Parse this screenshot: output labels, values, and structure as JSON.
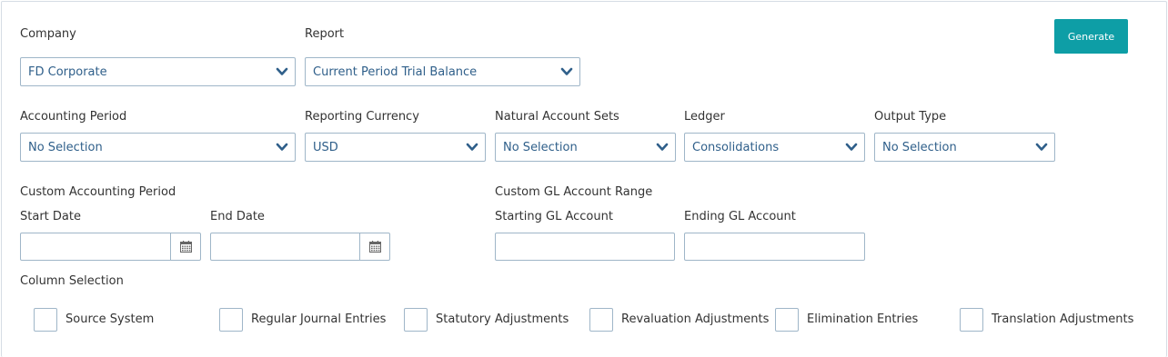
{
  "generate_label": "Generate",
  "icons": {
    "dropdown": "chevron-down-icon",
    "calendar": "calendar-icon"
  },
  "colors": {
    "accent": "#0e9ea6",
    "value_text": "#2f5f8a",
    "border": "#9fb6c8"
  },
  "fields": {
    "company": {
      "label": "Company",
      "value": "FD Corporate"
    },
    "report": {
      "label": "Report",
      "value": "Current Period Trial Balance"
    },
    "accounting_period": {
      "label": "Accounting Period",
      "value": "No Selection"
    },
    "reporting_currency": {
      "label": "Reporting Currency",
      "value": "USD"
    },
    "natural_account_sets": {
      "label": "Natural Account Sets",
      "value": "No Selection"
    },
    "ledger": {
      "label": "Ledger",
      "value": "Consolidations"
    },
    "output_type": {
      "label": "Output Type",
      "value": "No Selection"
    }
  },
  "custom_period": {
    "heading": "Custom Accounting Period",
    "start_label": "Start Date",
    "start_value": "",
    "end_label": "End Date",
    "end_value": ""
  },
  "gl_range": {
    "heading": "Custom GL Account Range",
    "start_label": "Starting GL Account",
    "start_value": "",
    "end_label": "Ending GL Account",
    "end_value": ""
  },
  "columns": {
    "heading": "Column Selection",
    "options": [
      {
        "label": "Source System",
        "checked": false
      },
      {
        "label": "Regular Journal Entries",
        "checked": false
      },
      {
        "label": "Statutory Adjustments",
        "checked": false
      },
      {
        "label": "Revaluation Adjustments",
        "checked": false
      },
      {
        "label": "Elimination Entries",
        "checked": false
      },
      {
        "label": "Translation Adjustments",
        "checked": false
      }
    ]
  }
}
